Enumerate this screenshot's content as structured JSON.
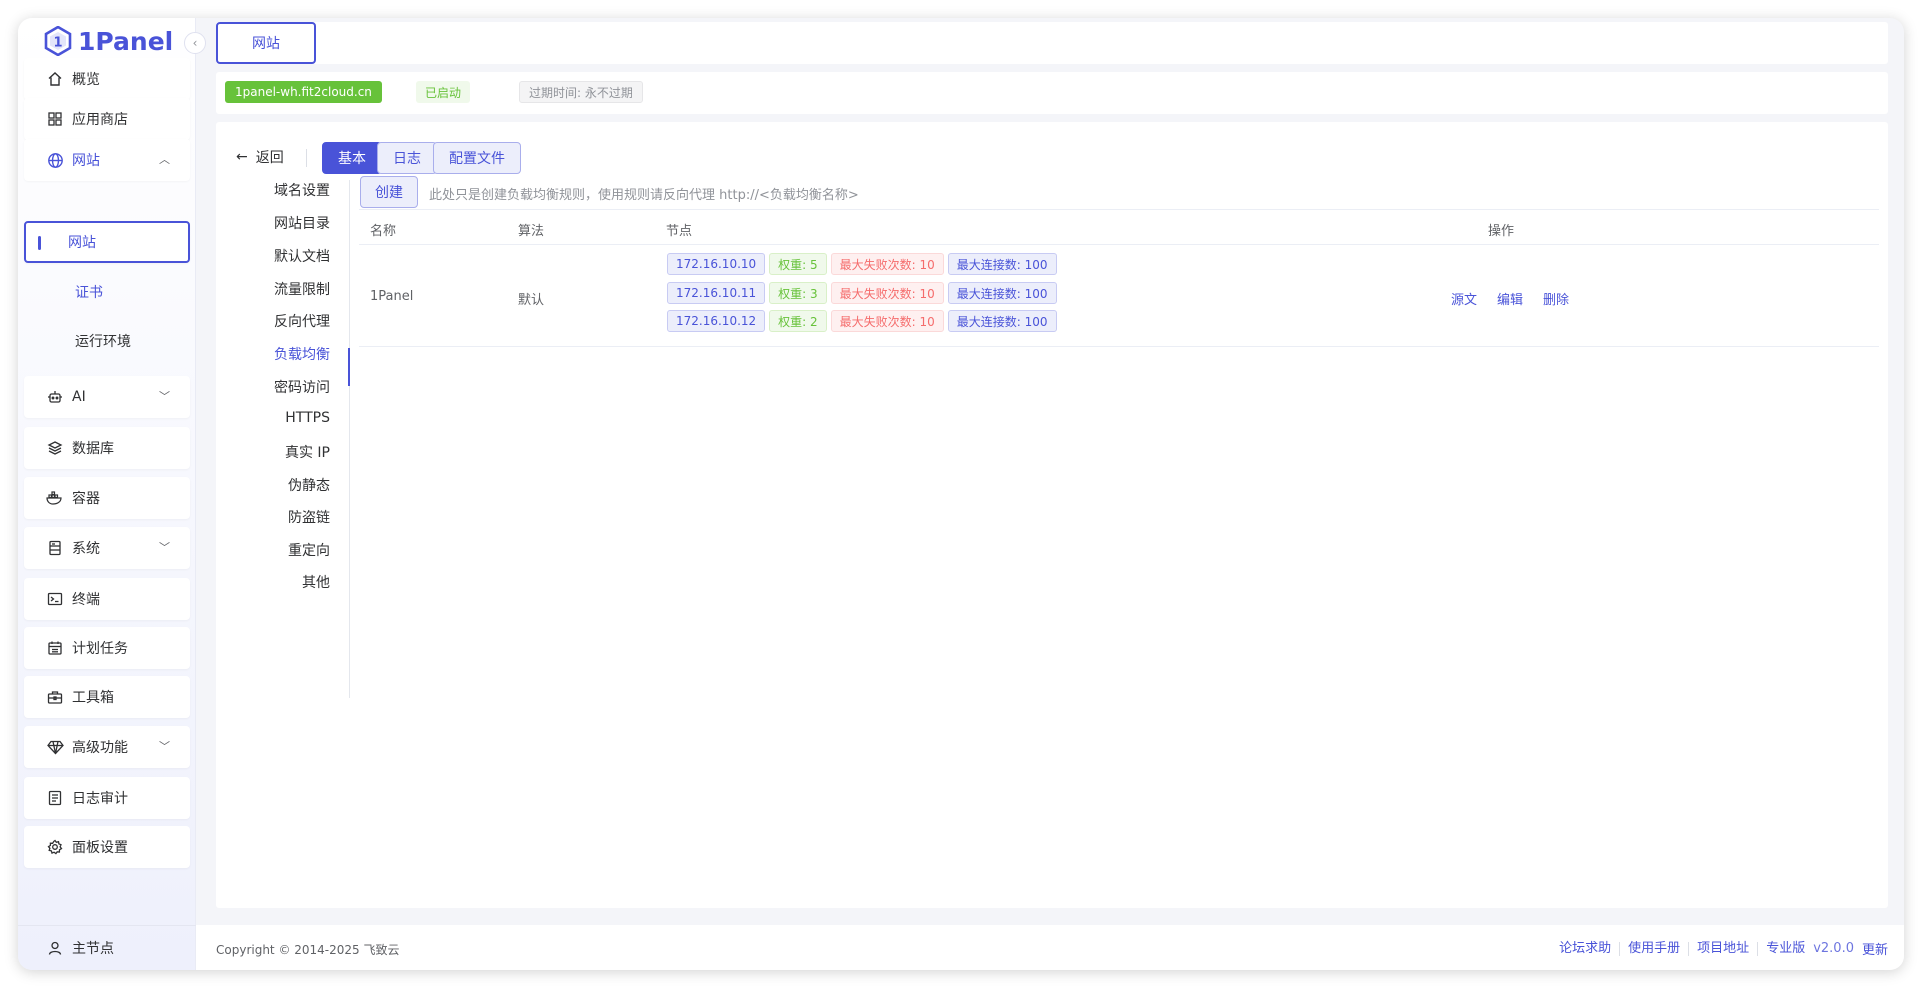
{
  "brand": {
    "name": "1Panel",
    "accent": "#4953d8"
  },
  "sidebar": {
    "items": [
      {
        "label": "概览",
        "icon": "home-icon"
      },
      {
        "label": "应用商店",
        "icon": "apps-grid-icon"
      },
      {
        "label": "网站",
        "icon": "globe-icon",
        "expanded": true
      },
      {
        "label": "网站",
        "sub": true,
        "active": true
      },
      {
        "label": "证书",
        "sub": true
      },
      {
        "label": "运行环境",
        "sub": true
      },
      {
        "label": "AI",
        "icon": "robot-icon"
      },
      {
        "label": "数据库",
        "icon": "layers-icon"
      },
      {
        "label": "容器",
        "icon": "docker-icon"
      },
      {
        "label": "系统",
        "icon": "server-icon"
      },
      {
        "label": "终端",
        "icon": "terminal-icon"
      },
      {
        "label": "计划任务",
        "icon": "calendar-icon"
      },
      {
        "label": "工具箱",
        "icon": "toolbox-icon"
      },
      {
        "label": "高级功能",
        "icon": "diamond-icon"
      },
      {
        "label": "日志审计",
        "icon": "log-icon"
      },
      {
        "label": "面板设置",
        "icon": "gear-icon"
      }
    ],
    "footer_label": "主节点"
  },
  "top_tab": {
    "label": "网站"
  },
  "info": {
    "domain": "1panel-wh.fit2cloud.cn",
    "status": "已启动",
    "expire": "过期时间: 永不过期"
  },
  "toolbar": {
    "back": "返回",
    "tabs": [
      "基本",
      "日志",
      "配置文件"
    ]
  },
  "side_nav": {
    "items": [
      "域名设置",
      "网站目录",
      "默认文档",
      "流量限制",
      "反向代理",
      "负载均衡",
      "密码访问",
      "HTTPS",
      "真实 IP",
      "伪静态",
      "防盗链",
      "重定向",
      "其他"
    ],
    "active": "负载均衡"
  },
  "lb": {
    "create": "创建",
    "hint": "此处只是创建负载均衡规则，使用规则请反向代理 http://<负载均衡名称>",
    "columns": {
      "name": "名称",
      "algo": "算法",
      "nodes": "节点",
      "ops": "操作"
    },
    "rows": [
      {
        "name": "1Panel",
        "algo": "默认",
        "nodes": [
          {
            "ip": "172.16.10.10",
            "weight": "权重: 5",
            "fails": "最大失败次数: 10",
            "conns": "最大连接数: 100"
          },
          {
            "ip": "172.16.10.11",
            "weight": "权重: 3",
            "fails": "最大失败次数: 10",
            "conns": "最大连接数: 100"
          },
          {
            "ip": "172.16.10.12",
            "weight": "权重: 2",
            "fails": "最大失败次数: 10",
            "conns": "最大连接数: 100"
          }
        ],
        "actions": [
          "源文",
          "编辑",
          "删除"
        ]
      }
    ]
  },
  "footer": {
    "copyright": "Copyright © 2014-2025 飞致云",
    "links": [
      "论坛求助",
      "使用手册",
      "项目地址",
      "专业版"
    ],
    "version": "v2.0.0",
    "update": "更新"
  }
}
